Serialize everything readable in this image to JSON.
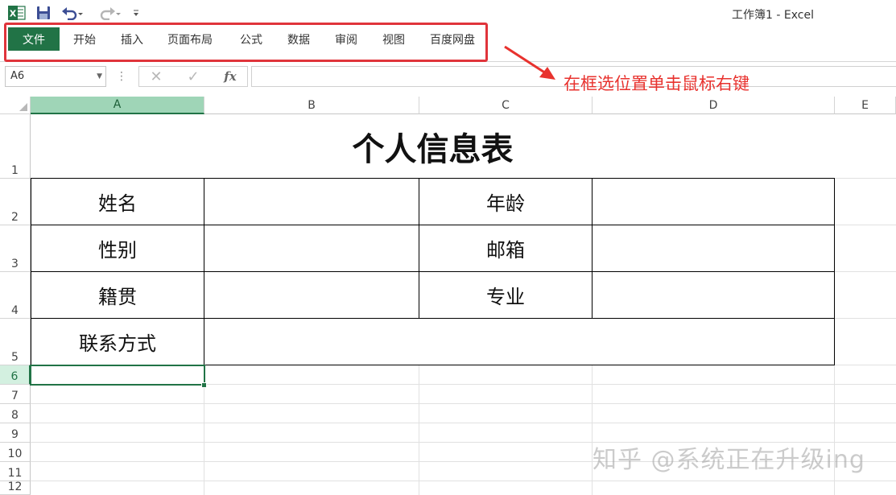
{
  "window": {
    "title": "工作簿1 - Excel"
  },
  "qat": {
    "icons": [
      "excel-logo-icon",
      "save-icon",
      "undo-icon",
      "redo-icon",
      "customize-qat-icon"
    ]
  },
  "ribbon": {
    "file_tab": "文件",
    "tabs": [
      "开始",
      "插入",
      "页面布局",
      "公式",
      "数据",
      "审阅",
      "视图",
      "百度网盘"
    ]
  },
  "formula_bar": {
    "name_box": "A6",
    "fx_label": "fx",
    "cancel_symbol": "✕",
    "enter_symbol": "✓",
    "value": ""
  },
  "annotation": {
    "text": "在框选位置单击鼠标右键",
    "color": "#e8322e"
  },
  "sheet": {
    "columns": [
      "A",
      "B",
      "C",
      "D",
      "E"
    ],
    "rows": [
      "1",
      "2",
      "3",
      "4",
      "5",
      "6",
      "7",
      "8",
      "9",
      "10",
      "11",
      "12"
    ],
    "selected_cell": "A6",
    "title": "个人信息表",
    "labels": {
      "name": "姓名",
      "age": "年龄",
      "gender": "性别",
      "email": "邮箱",
      "hometown": "籍贯",
      "major": "专业",
      "contact": "联系方式"
    }
  },
  "watermark": "知乎 @系统正在升级ing",
  "colors": {
    "accent": "#217346",
    "annotation_red": "#e8322e"
  }
}
